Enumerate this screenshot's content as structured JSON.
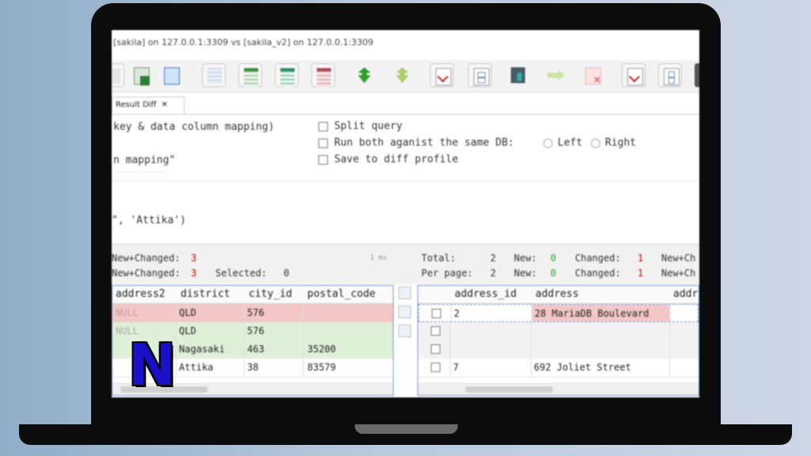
{
  "window": {
    "title": "[sakila] on 127.0.0.1:3309 vs [sakila_v2] on 127.0.0.1:3309"
  },
  "toolbar": {
    "icons": [
      "open-db-icon",
      "excel-export-icon",
      "copy-icon",
      "grid-layout-icon",
      "grid-green-icon",
      "grid-teal-icon",
      "grid-red-icon",
      "sync-down-icon",
      "sync-up-icon",
      "check-document-icon",
      "split-panel-icon",
      "dark-document-icon",
      "arrow-right-icon",
      "cancel-icon",
      "check-list-icon",
      "panel-icon"
    ]
  },
  "tab": {
    "label": "Result Diff",
    "close": "✕"
  },
  "options": {
    "mapping_text": "key & data column mapping)",
    "mapping_text2": "n mapping\"",
    "small_hint": "................",
    "split_query": "Split query",
    "run_both": "Run both aganist the same DB:",
    "left": "Left",
    "right": "Right",
    "save_profile": "Save to diff profile"
  },
  "editor": {
    "line": "\", 'Attika')"
  },
  "stats_left": {
    "line1_label": "New+Changed:",
    "line1_value": "3",
    "line2_label": "New+Changed:",
    "line2_value": "3",
    "selected_label": "Selected:",
    "selected_value": "0",
    "ms": "1 ms"
  },
  "stats_right": {
    "total_label": "Total:",
    "total_value": "2",
    "new_label": "New:",
    "new_value": "0",
    "changed_label": "Changed:",
    "changed_value": "1",
    "newch_label": "New+Ch",
    "perpage_label": "Per page:",
    "perpage_value": "2",
    "new2_label": "New:",
    "new2_value": "0",
    "changed2_label": "Changed:",
    "changed2_value": "1",
    "newch2_label": "New+Ch"
  },
  "grid_left": {
    "columns": [
      "address2",
      "district",
      "city_id",
      "postal_code"
    ],
    "rows": [
      {
        "address2": "NULL",
        "district": "QLD",
        "city_id": "576",
        "postal_code": "",
        "state": "changed"
      },
      {
        "address2": "NULL",
        "district": "QLD",
        "city_id": "576",
        "postal_code": "",
        "state": "new"
      },
      {
        "address2": "",
        "district": "Nagasaki",
        "city_id": "463",
        "postal_code": "35200",
        "state": "new"
      },
      {
        "address2": "",
        "district": "Attika",
        "city_id": "38",
        "postal_code": "83579",
        "state": "same"
      }
    ]
  },
  "grid_right": {
    "columns": [
      "address_id",
      "address",
      "addre"
    ],
    "rows": [
      {
        "address_id": "2",
        "address": "28 MariaDB Boulevard",
        "state": "changed"
      },
      {
        "address_id": "",
        "address": "",
        "state": "empty"
      },
      {
        "address_id": "",
        "address": "",
        "state": "empty"
      },
      {
        "address_id": "7",
        "address": "692 Joliet Street",
        "state": "same"
      }
    ]
  },
  "colors": {
    "changed": "#f4c7c7",
    "new": "#dff0d8",
    "selection": "#7a95d6",
    "logo": "#1a10c8"
  },
  "logo": {
    "letter": "N"
  }
}
